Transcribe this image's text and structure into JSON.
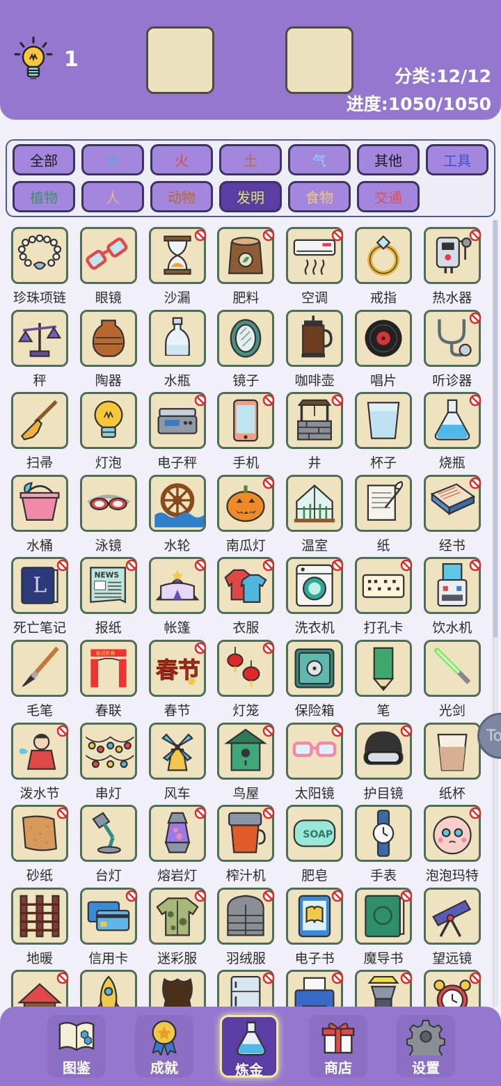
{
  "header": {
    "hint_count": "1",
    "category_stat": "分类:12/12",
    "progress_stat": "进度:1050/1050"
  },
  "categories": [
    {
      "label": "全部",
      "color": "#1a1a1a"
    },
    {
      "label": "水",
      "color": "#5aa6d6"
    },
    {
      "label": "火",
      "color": "#d94a3a"
    },
    {
      "label": "土",
      "color": "#b86a3a"
    },
    {
      "label": "气",
      "color": "#8fd6ee"
    },
    {
      "label": "其他",
      "color": "#1a1a1a"
    },
    {
      "label": "工具",
      "color": "#3b52d6"
    },
    {
      "label": "植物",
      "color": "#3f8f6a"
    },
    {
      "label": "人",
      "color": "#f0b090"
    },
    {
      "label": "动物",
      "color": "#b86a20"
    },
    {
      "label": "发明",
      "color": "#d9e86a",
      "active": true
    },
    {
      "label": "食物",
      "color": "#f0c878"
    },
    {
      "label": "交通",
      "color": "#e05050"
    }
  ],
  "items": [
    {
      "label": "珍珠项链",
      "icon": "pearl-necklace-icon",
      "locked": false
    },
    {
      "label": "眼镜",
      "icon": "glasses-icon",
      "locked": false
    },
    {
      "label": "沙漏",
      "icon": "hourglass-icon",
      "locked": true
    },
    {
      "label": "肥料",
      "icon": "fertilizer-bag-icon",
      "locked": true
    },
    {
      "label": "空调",
      "icon": "air-conditioner-icon",
      "locked": true
    },
    {
      "label": "戒指",
      "icon": "ring-icon",
      "locked": false
    },
    {
      "label": "热水器",
      "icon": "water-heater-icon",
      "locked": true
    },
    {
      "label": "秤",
      "icon": "balance-scale-icon",
      "locked": false
    },
    {
      "label": "陶器",
      "icon": "pottery-vase-icon",
      "locked": false
    },
    {
      "label": "水瓶",
      "icon": "water-bottle-icon",
      "locked": false
    },
    {
      "label": "镜子",
      "icon": "mirror-icon",
      "locked": false
    },
    {
      "label": "咖啡壶",
      "icon": "coffee-pot-icon",
      "locked": false
    },
    {
      "label": "唱片",
      "icon": "vinyl-record-icon",
      "locked": false
    },
    {
      "label": "听诊器",
      "icon": "stethoscope-icon",
      "locked": true
    },
    {
      "label": "扫帚",
      "icon": "broom-icon",
      "locked": false
    },
    {
      "label": "灯泡",
      "icon": "light-bulb-icon",
      "locked": false
    },
    {
      "label": "电子秤",
      "icon": "digital-scale-icon",
      "locked": true
    },
    {
      "label": "手机",
      "icon": "mobile-phone-icon",
      "locked": true
    },
    {
      "label": "井",
      "icon": "well-icon",
      "locked": true
    },
    {
      "label": "杯子",
      "icon": "cup-icon",
      "locked": false
    },
    {
      "label": "烧瓶",
      "icon": "flask-icon",
      "locked": true
    },
    {
      "label": "水桶",
      "icon": "bucket-icon",
      "locked": false
    },
    {
      "label": "泳镜",
      "icon": "goggles-icon",
      "locked": false
    },
    {
      "label": "水轮",
      "icon": "water-wheel-icon",
      "locked": false
    },
    {
      "label": "南瓜灯",
      "icon": "pumpkin-lantern-icon",
      "locked": true
    },
    {
      "label": "温室",
      "icon": "greenhouse-icon",
      "locked": false
    },
    {
      "label": "纸",
      "icon": "paper-scroll-icon",
      "locked": false
    },
    {
      "label": "经书",
      "icon": "scripture-book-icon",
      "locked": true
    },
    {
      "label": "死亡笔记",
      "icon": "death-note-icon",
      "locked": true
    },
    {
      "label": "报纸",
      "icon": "newspaper-icon",
      "locked": true
    },
    {
      "label": "帐篷",
      "icon": "tent-icon",
      "locked": true
    },
    {
      "label": "衣服",
      "icon": "clothes-icon",
      "locked": true
    },
    {
      "label": "洗衣机",
      "icon": "washing-machine-icon",
      "locked": true
    },
    {
      "label": "打孔卡",
      "icon": "punch-card-icon",
      "locked": true
    },
    {
      "label": "饮水机",
      "icon": "water-dispenser-icon",
      "locked": true
    },
    {
      "label": "毛笔",
      "icon": "brush-pen-icon",
      "locked": false
    },
    {
      "label": "春联",
      "icon": "spring-couplets-icon",
      "locked": false
    },
    {
      "label": "春节",
      "icon": "spring-festival-icon",
      "locked": true
    },
    {
      "label": "灯笼",
      "icon": "lantern-icon",
      "locked": true
    },
    {
      "label": "保险箱",
      "icon": "safe-icon",
      "locked": false
    },
    {
      "label": "笔",
      "icon": "pencil-icon",
      "locked": false
    },
    {
      "label": "光剑",
      "icon": "lightsaber-icon",
      "locked": false
    },
    {
      "label": "泼水节",
      "icon": "water-festival-icon",
      "locked": true
    },
    {
      "label": "串灯",
      "icon": "string-lights-icon",
      "locked": false
    },
    {
      "label": "风车",
      "icon": "windmill-icon",
      "locked": false
    },
    {
      "label": "鸟屋",
      "icon": "birdhouse-icon",
      "locked": true
    },
    {
      "label": "太阳镜",
      "icon": "sunglasses-icon",
      "locked": true
    },
    {
      "label": "护目镜",
      "icon": "protective-goggles-icon",
      "locked": true
    },
    {
      "label": "纸杯",
      "icon": "paper-cup-icon",
      "locked": false
    },
    {
      "label": "砂纸",
      "icon": "sandpaper-icon",
      "locked": true
    },
    {
      "label": "台灯",
      "icon": "desk-lamp-icon",
      "locked": false
    },
    {
      "label": "熔岩灯",
      "icon": "lava-lamp-icon",
      "locked": true
    },
    {
      "label": "榨汁机",
      "icon": "juicer-icon",
      "locked": true
    },
    {
      "label": "肥皂",
      "icon": "soap-icon",
      "locked": false
    },
    {
      "label": "手表",
      "icon": "wristwatch-icon",
      "locked": false
    },
    {
      "label": "泡泡玛特",
      "icon": "pop-mart-figure-icon",
      "locked": true
    },
    {
      "label": "地暖",
      "icon": "floor-heating-icon",
      "locked": false
    },
    {
      "label": "信用卡",
      "icon": "credit-card-icon",
      "locked": true
    },
    {
      "label": "迷彩服",
      "icon": "camouflage-shirt-icon",
      "locked": true
    },
    {
      "label": "羽绒服",
      "icon": "down-jacket-icon",
      "locked": true
    },
    {
      "label": "电子书",
      "icon": "ebook-reader-icon",
      "locked": true
    },
    {
      "label": "魔导书",
      "icon": "grimoire-icon",
      "locked": true
    },
    {
      "label": "望远镜",
      "icon": "telescope-icon",
      "locked": false
    },
    {
      "label": "",
      "icon": "log-cabin-icon",
      "locked": true
    },
    {
      "label": "",
      "icon": "rocket-icon",
      "locked": false
    },
    {
      "label": "",
      "icon": "leather-icon",
      "locked": false
    },
    {
      "label": "",
      "icon": "refrigerator-icon",
      "locked": true
    },
    {
      "label": "",
      "icon": "printer-icon",
      "locked": true
    },
    {
      "label": "",
      "icon": "lamp-device-icon",
      "locked": true
    },
    {
      "label": "",
      "icon": "alarm-clock-icon",
      "locked": true
    }
  ],
  "floating_button": {
    "label": "To"
  },
  "nav": [
    {
      "label": "图鉴",
      "icon": "encyclopedia-book-icon"
    },
    {
      "label": "成就",
      "icon": "achievement-medal-icon"
    },
    {
      "label": "炼金",
      "icon": "alchemy-flask-icon",
      "active": true
    },
    {
      "label": "商店",
      "icon": "shop-gift-icon"
    },
    {
      "label": "设置",
      "icon": "settings-gear-icon"
    }
  ]
}
